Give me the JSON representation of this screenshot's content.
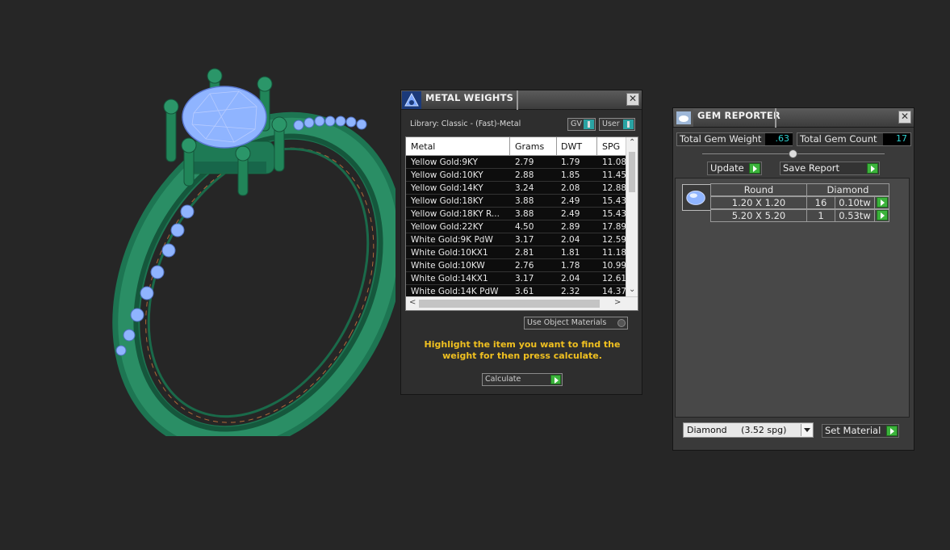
{
  "metal_weights": {
    "title": "METAL WEIGHTS",
    "library": "Library: Classic - (Fast)-Metal",
    "gv_label": "GV",
    "user_label": "User",
    "columns": [
      "Metal",
      "Grams",
      "DWT",
      "SPG"
    ],
    "rows": [
      [
        "Yellow Gold:9KY",
        "2.79",
        "1.79",
        "11.08"
      ],
      [
        "Yellow Gold:10KY",
        "2.88",
        "1.85",
        "11.45"
      ],
      [
        "Yellow Gold:14KY",
        "3.24",
        "2.08",
        "12.88"
      ],
      [
        "Yellow Gold:18KY",
        "3.88",
        "2.49",
        "15.43"
      ],
      [
        "Yellow Gold:18KY R...",
        "3.88",
        "2.49",
        "15.43"
      ],
      [
        "Yellow Gold:22KY",
        "4.50",
        "2.89",
        "17.89"
      ],
      [
        "White Gold:9K PdW",
        "3.17",
        "2.04",
        "12.59"
      ],
      [
        "White Gold:10KX1",
        "2.81",
        "1.81",
        "11.18"
      ],
      [
        "White Gold:10KW",
        "2.76",
        "1.78",
        "10.99"
      ],
      [
        "White Gold:14KX1",
        "3.17",
        "2.04",
        "12.61"
      ],
      [
        "White Gold:14K PdW",
        "3.61",
        "2.32",
        "14.37"
      ]
    ],
    "use_object_materials": "Use Object Materials",
    "hint": "Highlight the item you want to find the weight for then press calculate.",
    "calculate_label": "Calculate"
  },
  "gem_reporter": {
    "title": "GEM REPORTER",
    "total_weight_label": "Total Gem Weight",
    "total_weight_value": ".63",
    "total_count_label": "Total Gem Count",
    "total_count_value": "17",
    "update_label": "Update",
    "save_report_label": "Save Report",
    "shape_header": "Round",
    "material_header": "Diamond",
    "gems": [
      {
        "size": "1.20 X 1.20",
        "count": "16",
        "weight": "0.10tw"
      },
      {
        "size": "5.20 X 5.20",
        "count": "1",
        "weight": "0.53tw"
      }
    ],
    "material_select": "Diamond     (3.52 spg)",
    "set_material_label": "Set Material"
  },
  "colors": {
    "ring_body": "#1f7a55",
    "gem": "#8fb4ff",
    "hint_text": "#f0c020",
    "value_text": "#2fd0d0",
    "action_green": "#3bb33b"
  }
}
